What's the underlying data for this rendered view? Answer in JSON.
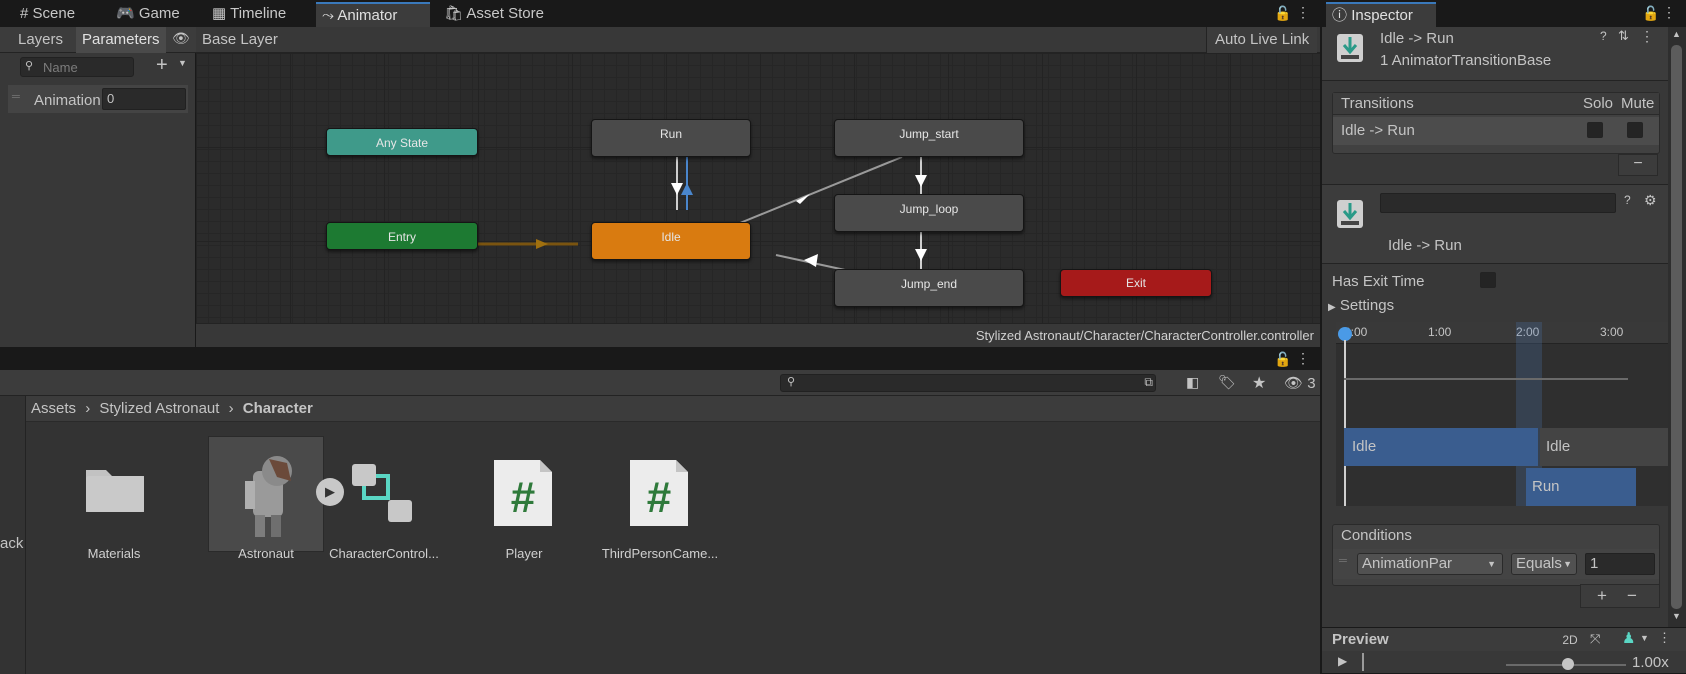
{
  "tabs": [
    "Scene",
    "Game",
    "Timeline",
    "Animator",
    "Asset Store"
  ],
  "animator": {
    "subtabs": [
      "Layers",
      "Parameters"
    ],
    "layer": "Base Layer",
    "auto_live_link": "Auto Live Link",
    "search_placeholder": "Name",
    "param_name": "Animation",
    "param_value": "0",
    "path": "Stylized Astronaut/Character/CharacterController.controller",
    "nodes": {
      "any_state": "Any State",
      "entry": "Entry",
      "run": "Run",
      "idle": "Idle",
      "jump_start": "Jump_start",
      "jump_loop": "Jump_loop",
      "jump_end": "Jump_end",
      "exit": "Exit"
    }
  },
  "project": {
    "breadcrumb": [
      "Assets",
      "Stylized Astronaut",
      "Character"
    ],
    "hidden_count": "3",
    "left_edge": "ack",
    "assets": [
      "Materials",
      "Astronaut",
      "CharacterControl...",
      "Player",
      "ThirdPersonCame..."
    ]
  },
  "inspector": {
    "tab": "Inspector",
    "title": "Idle -> Run",
    "subtitle": "1 AnimatorTransitionBase",
    "transitions_header": "Transitions",
    "solo": "Solo",
    "mute": "Mute",
    "transition_item": "Idle -> Run",
    "transition_name": "Idle -> Run",
    "has_exit_time": "Has Exit Time",
    "settings": "Settings",
    "timeline_ticks": [
      "0:00",
      "1:00",
      "2:00",
      "3:00"
    ],
    "timeline_bars": {
      "idle1": "Idle",
      "idle2": "Idle",
      "run": "Run"
    },
    "conditions": "Conditions",
    "condition_param": "AnimationPar",
    "condition_op": "Equals",
    "condition_value": "1",
    "preview": "Preview",
    "preview_mode": "2D",
    "speed": "1.00x"
  },
  "colors": {
    "any_state": "#3f9a8a",
    "entry": "#1d7a32",
    "idle": "#d97b10",
    "exit": "#a61a1a",
    "accent": "#3a79bb"
  }
}
